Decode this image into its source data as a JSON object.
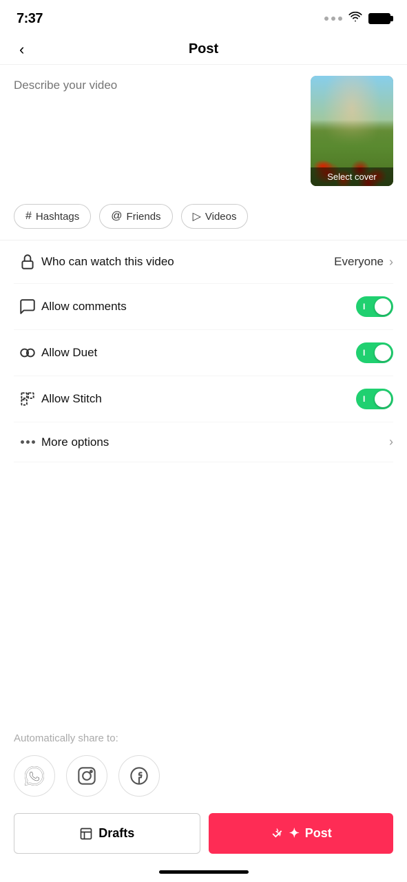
{
  "statusBar": {
    "time": "7:37"
  },
  "header": {
    "backLabel": "‹",
    "title": "Post"
  },
  "description": {
    "placeholder": "Describe your video"
  },
  "selectCover": {
    "label": "Select cover"
  },
  "tags": [
    {
      "id": "hashtags",
      "icon": "#",
      "label": "Hashtags"
    },
    {
      "id": "friends",
      "icon": "@",
      "label": "Friends"
    },
    {
      "id": "videos",
      "icon": "▷",
      "label": "Videos"
    }
  ],
  "settings": {
    "whoCanWatch": {
      "label": "Who can watch this video",
      "value": "Everyone"
    },
    "allowComments": {
      "label": "Allow comments",
      "enabled": true
    },
    "allowDuet": {
      "label": "Allow Duet",
      "enabled": true
    },
    "allowStitch": {
      "label": "Allow Stitch",
      "enabled": true
    },
    "moreOptions": {
      "label": "More options"
    }
  },
  "shareSection": {
    "label": "Automatically share to:"
  },
  "bottomButtons": {
    "drafts": "Drafts",
    "post": "Post"
  }
}
